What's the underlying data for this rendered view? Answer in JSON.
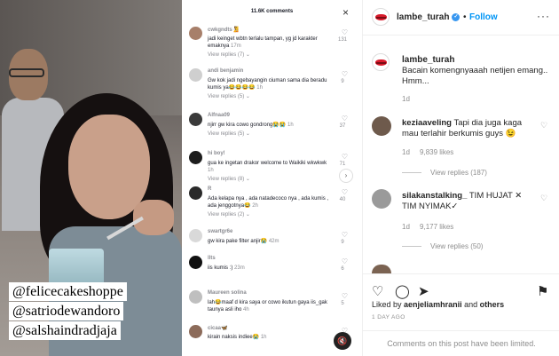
{
  "photo": {
    "tags": [
      "@felicecakeshoppe",
      "@satriodewandoro",
      "@salshaindradjaja"
    ]
  },
  "tiktok": {
    "count": "11.6K comments",
    "close": "×",
    "scroll_glyph": "›",
    "sound_glyph": "🔇",
    "comments": [
      {
        "user": "cwkgndts🧏",
        "text": "jadi keinget wbtn terlalu tampan, yg jd karakter emaknya",
        "ago": "17m",
        "likes": "131",
        "replies": "View replies (7) ⌄",
        "avatar": "#a77f6a"
      },
      {
        "user": "andi benjamin",
        "text": "Gw kok jadi ngebayangin ciuman sama dia beradu kumis ya😂😂😂😂",
        "ago": "1h",
        "likes": "9",
        "replies": "View replies (5) ⌄",
        "avatar": "#cfcfcf"
      },
      {
        "user": "Alfnaa09",
        "text": "njirr gw kira cowo gondrong😭😭",
        "ago": "1h",
        "likes": "37",
        "replies": "View replies (5) ⌄",
        "avatar": "#3a3a3a"
      },
      {
        "user": "hi boy!",
        "text": "gua ke ingetan drakor welcome to Waikiki wkwkwk",
        "ago": "1h",
        "likes": "71",
        "replies": "View replies (8) ⌄",
        "avatar": "#1d1d1d"
      },
      {
        "user": "R",
        "text": "Ada kelapa nya , ada natadecoco nya , ada kumis , ada jenggotnya😂",
        "ago": "2h",
        "likes": "40",
        "replies": "View replies (2) ⌄",
        "avatar": "#2a2a2a"
      },
      {
        "user": "swartgr6e",
        "text": "gw kira pake filter anjir😭",
        "ago": "42m",
        "likes": "9",
        "replies": "",
        "avatar": "#d9d9d9"
      },
      {
        "user": "llts",
        "text": "iis kumis :)",
        "ago": "23m",
        "likes": "6",
        "replies": "",
        "avatar": "#111111"
      },
      {
        "user": "Maureen solina",
        "text": "lah😂maaf d kira saya or cowo ikutun gaya iis_gak taunya asli iho",
        "ago": "4h",
        "likes": "5",
        "replies": "",
        "avatar": "#bfbfbf"
      },
      {
        "user": "cicaa🦋",
        "text": "kirain naksis indiee😭",
        "ago": "1h",
        "likes": "",
        "replies": "",
        "avatar": "#8c6b5a"
      }
    ]
  },
  "instagram": {
    "account": "lambe_turah",
    "verified_glyph": "✓",
    "follow_separator": "•",
    "follow": "Follow",
    "more": "···",
    "caption": "Bacain komengnyaaah netijen emang.. Hmm...",
    "caption_time": "1d",
    "comments": [
      {
        "user": "keziaaveling",
        "text": "Tapi dia juga kaga mau terlahir berkumis guys 😉",
        "time": "1d",
        "likes": "9,839 likes",
        "replies": "View replies (187)",
        "avatar": "#6e5a4c"
      },
      {
        "user": "silakanstalking_",
        "text": "TIM HUJAT ✕ TIM NYIMAK✓",
        "time": "1d",
        "likes": "9,177 likes",
        "replies": "View replies (50)",
        "avatar": "#9a9a9a"
      }
    ],
    "liked_by_prefix": "Liked by",
    "liked_by_user": "aenjeliamhranii",
    "liked_by_and": "and",
    "liked_by_others": "others",
    "post_time": "1 DAY AGO",
    "limited": "Comments on this post have been limited.",
    "icons": {
      "like": "♡",
      "comment": "◯",
      "share": "➤",
      "save": "⚑",
      "heart_small": "♡"
    }
  }
}
